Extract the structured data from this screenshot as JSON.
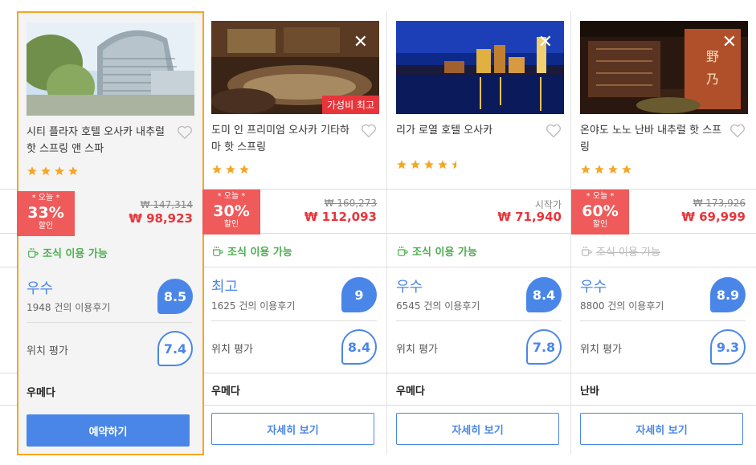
{
  "hotels": [
    {
      "name": "시티 플라자 호텔 오사카 내추럴 핫 스프링 앤 스파",
      "stars": 4,
      "deal": {
        "today": "* 오늘 *",
        "percent": "33%",
        "off": "할인"
      },
      "original_price": "₩ 147,314",
      "price": "₩ 98,923",
      "breakfast": "조식 이용 가능",
      "rating_word": "우수",
      "reviews": "1948 건의 이용후기",
      "score": "8.5",
      "location_label": "위치 평가",
      "location_score": "7.4",
      "area": "우메다",
      "button": "예약하기"
    },
    {
      "name": "도미 인 프리미엄 오사카 기타하마 핫 스프링",
      "stars": 3,
      "badge": "가성비 최고",
      "deal": {
        "today": "* 오늘 *",
        "percent": "30%",
        "off": "할인"
      },
      "original_price": "₩ 160,273",
      "price": "₩ 112,093",
      "breakfast": "조식 이용 가능",
      "rating_word": "최고",
      "reviews": "1625 건의 이용후기",
      "score": "9",
      "location_label": "위치 평가",
      "location_score": "8.4",
      "area": "우메다",
      "button": "자세히 보기"
    },
    {
      "name": "리가 로열 호텔 오사카",
      "stars": 4.5,
      "from_label": "시작가",
      "price": "₩ 71,940",
      "breakfast": "조식 이용 가능",
      "rating_word": "우수",
      "reviews": "6545 건의 이용후기",
      "score": "8.4",
      "location_label": "위치 평가",
      "location_score": "7.8",
      "area": "우메다",
      "button": "자세히 보기"
    },
    {
      "name": "온야도 노노 난바 내추럴 핫 스프링",
      "stars": 4,
      "deal": {
        "today": "* 오늘 *",
        "percent": "60%",
        "off": "할인"
      },
      "original_price": "₩ 173,926",
      "price": "₩ 69,999",
      "breakfast": "조식 이용 가능",
      "rating_word": "우수",
      "reviews": "8800 건의 이용후기",
      "score": "8.9",
      "location_label": "위치 평가",
      "location_score": "9.3",
      "area": "난바",
      "button": "자세히 보기"
    }
  ],
  "colors": {
    "accent": "#4a86e8",
    "price": "#e8353b",
    "deal": "#ef5a5a",
    "selected_border": "#f5a623",
    "breakfast": "#4caf50",
    "star": "#f5a623"
  },
  "icons": [
    "close-icon",
    "heart-icon",
    "star-icon",
    "coffee-cup-icon"
  ]
}
